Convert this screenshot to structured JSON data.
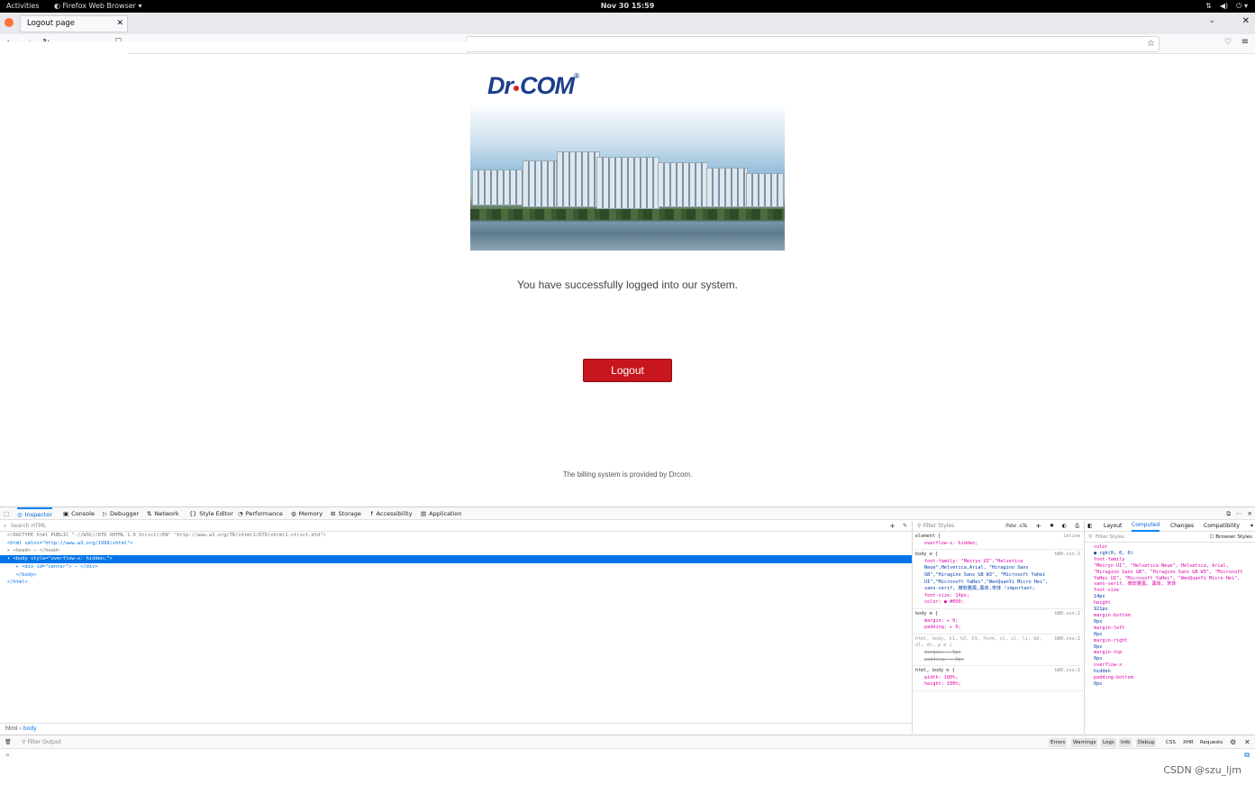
{
  "system": {
    "activities": "Activities",
    "app_name": "Firefox Web Browser ▾",
    "clock": "Nov 30  15:59"
  },
  "browser": {
    "tab_title": "Logout page"
  },
  "page": {
    "logo_left": "Dr",
    "logo_right": "COM",
    "logo_mark": "®",
    "message": "You have successfully logged into our system.",
    "logout_label": "Logout",
    "footer": "The billing system is provided by Drcom.",
    "logout_color": "#c7161d"
  },
  "devtools": {
    "tabs": [
      "Inspector",
      "Console",
      "Debugger",
      "Network",
      "Style Editor",
      "Performance",
      "Memory",
      "Storage",
      "Accessibility",
      "Application"
    ],
    "search_placeholder": "Search HTML",
    "markup": [
      "<!DOCTYPE html PUBLIC \"-//W3C//DTD XHTML 1.0 Strict//EN\" \"http://www.w3.org/TR/xhtml1/DTD/xhtml1-strict.dtd\">",
      "<html xmlns=\"http://www.w3.org/1999/xhtml\">",
      "▸ <head> ⋯ </head>",
      "▾ <body style=\"overflow-x: hidden;\">",
      "   ▸ <div id=\"center\"> ⋯ </div>",
      "   </body>",
      "</html>"
    ],
    "breadcrumb": [
      "html",
      "body"
    ],
    "rules_filter": "Filter Styles",
    "rules_toggles": ":hov  .cls",
    "rules": [
      {
        "selector": "element {",
        "source": "inline",
        "decls": [
          "overflow-x: hidden;"
        ]
      },
      {
        "selector": "body ⚙ {",
        "source": "b80.css:2",
        "decls": [
          "font-family: \"Meiryo UI\",\"Helvetica",
          "Neue\",Helvetica,Arial, \"Hiragino Sans",
          "GB\",\"Hiragino Sans GB W3\", \"Microsoft Yahei",
          "UI\",\"Microsoft YaHei\",\"WenQuanYi Micro Hei\",",
          "sans-serif, 微软雅黑,黑体,宋体 !important;",
          "font-size: 14px;",
          "color: ● #000;"
        ]
      },
      {
        "selector": "body ⚙ {",
        "source": "b80.css:2",
        "decls": [
          "margin: ▸ 0;",
          "padding: ▸ 0;"
        ]
      },
      {
        "selector": "html, body, h1, h2, h3, form, ol, ul, li, dd, dl, dt, p ⚙ {",
        "source": "b80.css:2",
        "decls": [
          "margin: ▸ 0px",
          "padding: ▸ 0px"
        ]
      },
      {
        "selector": "html, body ⚙ {",
        "source": "b80.css:2",
        "decls": [
          "width: 100%;",
          "height: 100%;"
        ]
      }
    ],
    "computed_tabs": [
      "Layout",
      "Computed",
      "Changes",
      "Compatibility"
    ],
    "computed_filter": "Filter Styles",
    "browser_styles": "Browser Styles",
    "computed": [
      {
        "prop": "color",
        "val": "● rgb(0, 0, 0)"
      },
      {
        "prop": "font-family",
        "val": "\"Meiryo UI\", \"Helvetica Neue\", Helvetica, Arial, \"Hiragino Sans GB\", \"Hiragino Sans GB W3\", \"Microsoft YaHei UI\", \"Microsoft YaHei\", \"WenQuanYi Micro Hei\", sans-serif, 微软雅黑, 黑体, 宋体"
      },
      {
        "prop": "font-size",
        "val": "14px"
      },
      {
        "prop": "height",
        "val": "921px"
      },
      {
        "prop": "margin-bottom",
        "val": "0px"
      },
      {
        "prop": "margin-left",
        "val": "0px"
      },
      {
        "prop": "margin-right",
        "val": "0px"
      },
      {
        "prop": "margin-top",
        "val": "0px"
      },
      {
        "prop": "overflow-x",
        "val": "hidden"
      },
      {
        "prop": "padding-bottom",
        "val": "0px"
      }
    ],
    "console_filter": "Filter Output",
    "console_levels": [
      "Errors",
      "Warnings",
      "Logs",
      "Info",
      "Debug"
    ],
    "console_extra": [
      "CSS",
      "XHR",
      "Requests"
    ],
    "console_prompt": "»"
  },
  "watermark": "CSDN @szu_ljm"
}
